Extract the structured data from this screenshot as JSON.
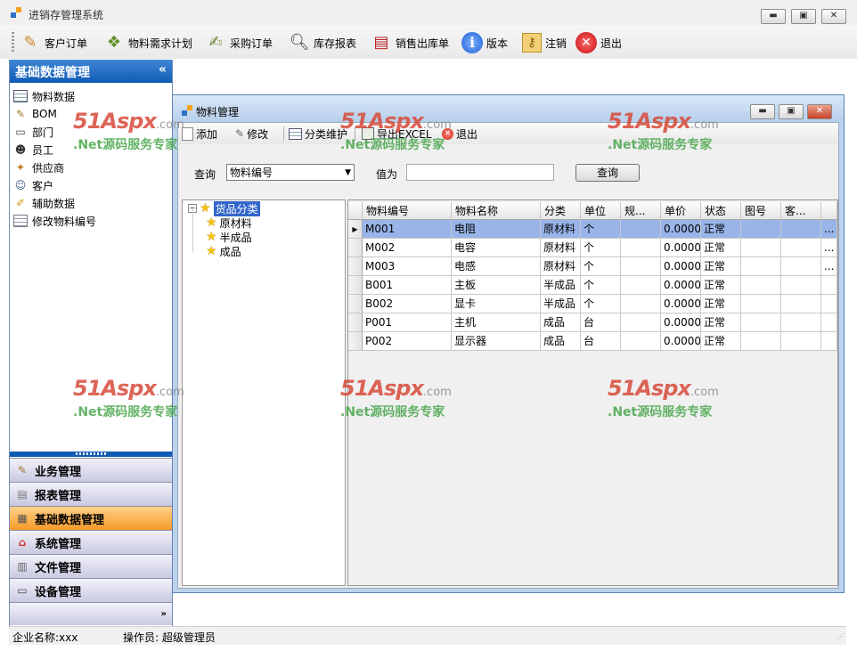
{
  "window": {
    "title": "进销存管理系统"
  },
  "toolbar": [
    {
      "label": "客户订单",
      "icon": "customer-order-icon"
    },
    {
      "label": "物料需求计划",
      "icon": "material-plan-icon"
    },
    {
      "label": "采购订单",
      "icon": "purchase-order-icon"
    },
    {
      "label": "库存报表",
      "icon": "inventory-report-icon"
    },
    {
      "label": "销售出库单",
      "icon": "sales-outbound-icon"
    },
    {
      "label": "版本",
      "icon": "info-icon"
    },
    {
      "label": "注销",
      "icon": "key-icon"
    },
    {
      "label": "退出",
      "icon": "exit-icon"
    }
  ],
  "sidebar": {
    "header": "基础数据管理",
    "items": [
      {
        "label": "物料数据",
        "icon": "grid-icon"
      },
      {
        "label": "BOM",
        "icon": "bom-icon"
      },
      {
        "label": "部门",
        "icon": "department-icon"
      },
      {
        "label": "员工",
        "icon": "employee-icon"
      },
      {
        "label": "供应商",
        "icon": "supplier-icon"
      },
      {
        "label": "客户",
        "icon": "customer-icon"
      },
      {
        "label": "辅助数据",
        "icon": "aux-data-icon"
      },
      {
        "label": "修改物料编号",
        "icon": "edit-code-icon"
      }
    ],
    "groups": [
      {
        "label": "业务管理",
        "active": false
      },
      {
        "label": "报表管理",
        "active": false
      },
      {
        "label": "基础数据管理",
        "active": true
      },
      {
        "label": "系统管理",
        "active": false
      },
      {
        "label": "文件管理",
        "active": false
      },
      {
        "label": "设备管理",
        "active": false
      }
    ]
  },
  "child": {
    "title": "物料管理",
    "toolbar": {
      "add": "添加",
      "edit": "修改",
      "category": "分类维护",
      "export": "导出EXCEL",
      "exit": "退出"
    },
    "query": {
      "label": "查询",
      "field_selected": "物料编号",
      "value_label": "值为",
      "value": "",
      "button": "查询"
    },
    "tree": {
      "root": "货品分类",
      "children": [
        "原材料",
        "半成品",
        "成品"
      ]
    },
    "grid": {
      "columns": [
        "物料编号",
        "物料名称",
        "分类",
        "单位",
        "规...",
        "单价",
        "状态",
        "图号",
        "客..."
      ],
      "rows": [
        [
          "M001",
          "电阻",
          "原材料",
          "个",
          "",
          "0.0000",
          "正常",
          "",
          "",
          "..."
        ],
        [
          "M002",
          "电容",
          "原材料",
          "个",
          "",
          "0.0000",
          "正常",
          "",
          "",
          "..."
        ],
        [
          "M003",
          "电感",
          "原材料",
          "个",
          "",
          "0.0000",
          "正常",
          "",
          "",
          "..."
        ],
        [
          "B001",
          "主板",
          "半成品",
          "个",
          "",
          "0.0000",
          "正常",
          "",
          "",
          ""
        ],
        [
          "B002",
          "显卡",
          "半成品",
          "个",
          "",
          "0.0000",
          "正常",
          "",
          "",
          ""
        ],
        [
          "P001",
          "主机",
          "成品",
          "台",
          "",
          "0.0000",
          "正常",
          "",
          "",
          ""
        ],
        [
          "P002",
          "显示器",
          "成品",
          "台",
          "",
          "0.0000",
          "正常",
          "",
          "",
          ""
        ]
      ],
      "selected_row": 0
    }
  },
  "statusbar": {
    "company": "企业名称:xxx",
    "operator": "操作员: 超级管理员"
  },
  "watermark": {
    "brand": "51Aspx",
    "suffix": ".com",
    "tagline": ".Net源码服务专家"
  }
}
